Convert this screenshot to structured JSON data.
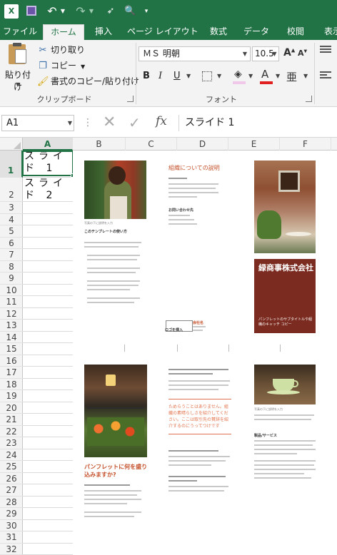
{
  "qat": {
    "app_icon_label": "X",
    "icons": [
      "excel-logo-icon",
      "save-icon",
      "undo-icon",
      "redo-icon",
      "touch-mode-icon",
      "print-preview-icon",
      "customize-qat-icon"
    ]
  },
  "tabs": {
    "file": "ファイル",
    "home": "ホーム",
    "insert": "挿入",
    "page_layout": "ページ レイアウト",
    "formulas": "数式",
    "data": "データ",
    "review": "校閲",
    "view": "表示"
  },
  "ribbon": {
    "paste_label": "貼り付け",
    "cut_label": "切り取り",
    "copy_label": "コピー",
    "format_painter_label": "書式のコピー/貼り付け",
    "clipboard_group": "クリップボード",
    "font_name": "ＭＳ 明朝",
    "font_size": "10.5",
    "bold": "B",
    "italic": "I",
    "underline": "U",
    "font_color_glyph": "A",
    "grow_font_glyph": "A",
    "shrink_font_glyph": "A",
    "phonetic_glyph": "亜",
    "font_group": "フォント",
    "accent_color": "#217346",
    "font_color": "#e02020",
    "fill_color": "#f0c8e9"
  },
  "formula_bar": {
    "name_box": "A1",
    "fx_label": "fx",
    "formula": "スライド 1"
  },
  "grid": {
    "columns": [
      "A",
      "B",
      "C",
      "D",
      "E",
      "F"
    ],
    "active_column": "A",
    "rows": [
      "1",
      "2",
      "3",
      "4",
      "5",
      "6",
      "7",
      "8",
      "9",
      "10",
      "11",
      "12",
      "13",
      "14",
      "15",
      "16",
      "17",
      "18",
      "19",
      "20",
      "21",
      "22",
      "23",
      "24",
      "25",
      "26",
      "27",
      "28",
      "29",
      "30",
      "31",
      "32"
    ],
    "active_row": "1",
    "cells": {
      "A1": "スライド 1",
      "A2": "スライド 2"
    }
  },
  "brochure": {
    "page1": {
      "photo_caption": "写真の下に説明を入力",
      "how_to_heading": "このテンプレートの使い方",
      "about_title": "組織についての説明",
      "contact_heading": "お問い合わせ先",
      "brand_name": "緑商事株式会社",
      "brand_tagline": "パンフレットのサブタイトルや組織のキャッチ コピー",
      "logo_label": "ロゴを挿入",
      "logo_company": "会社名"
    },
    "page2": {
      "headline_question": "パンフレットに何を盛り込みますか?",
      "quote": "ためらうことはありません。組織の素晴らしさを紹介してください。ここは取引先の賛辞を紹介するのにうってつけです",
      "photo_caption": "写真の下に説明を入力",
      "services_heading": "製品/サービス"
    }
  }
}
